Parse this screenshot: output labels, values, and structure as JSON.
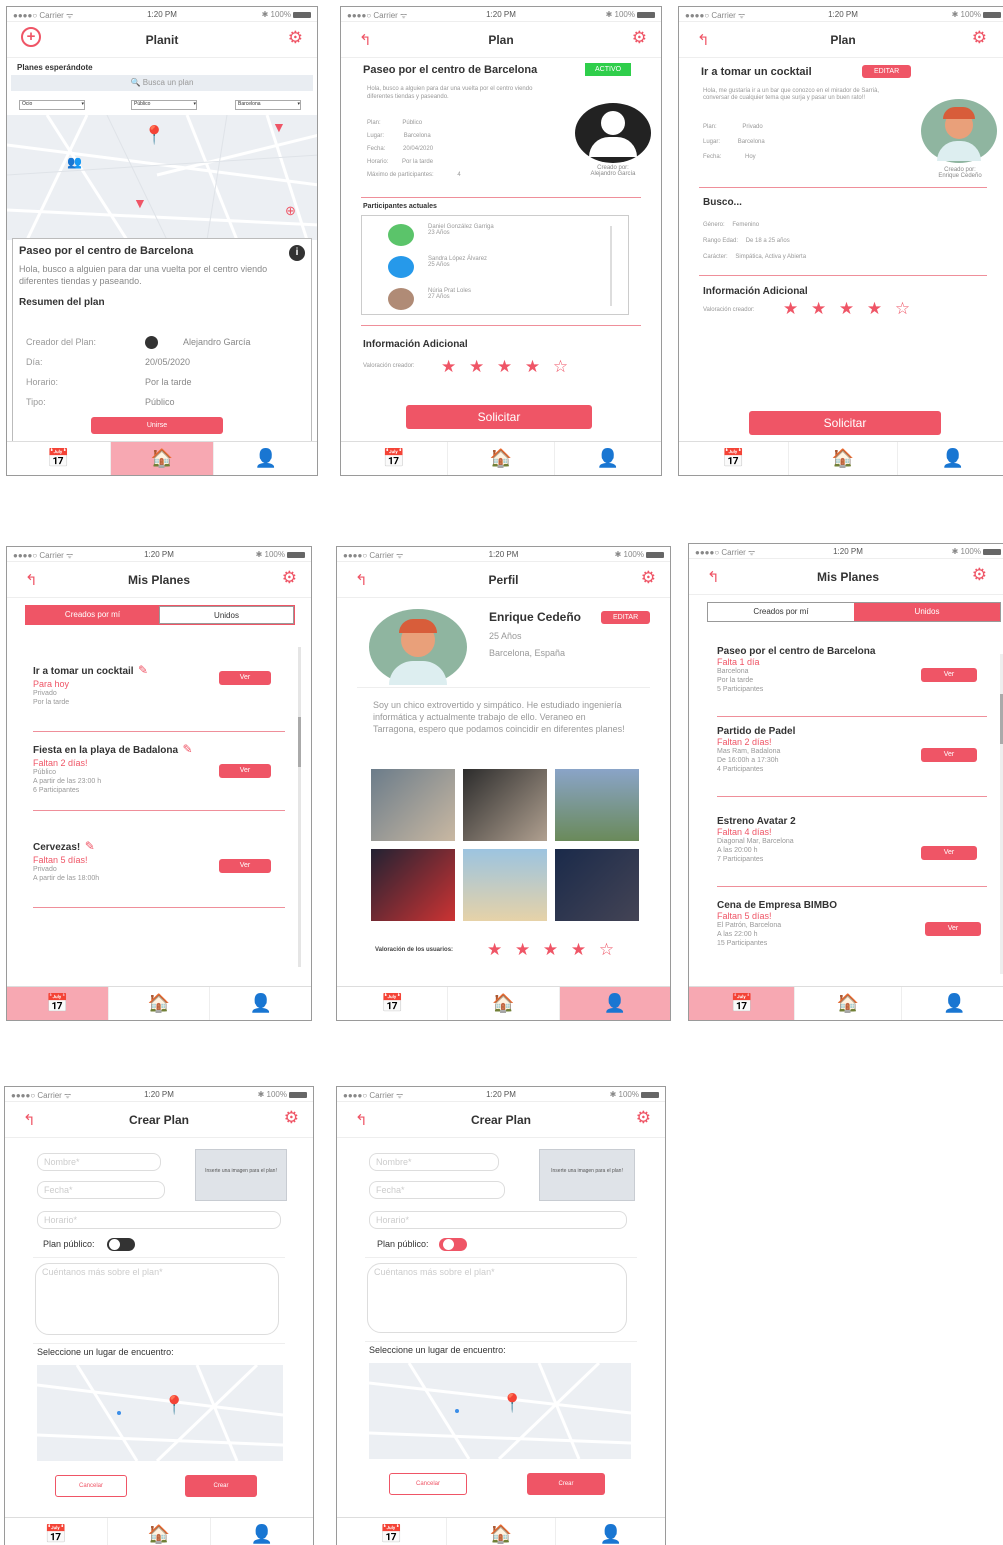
{
  "status": {
    "carrier": "●●●●○ Carrier ᯤ",
    "time": "1:20 PM",
    "battery": "✱ 100%"
  },
  "tabs": {
    "calendar": "📅",
    "home": "🏠",
    "profile": "👤"
  },
  "s1": {
    "title": "Planit",
    "section": "Planes esperándote",
    "search": "🔍 Busca un plan",
    "filters": [
      "Ocio",
      "Público",
      "Barcelona"
    ],
    "card": {
      "title": "Paseo por el centro de Barcelona",
      "desc": "Hola, busco a alguien para dar una vuelta por el centro viendo diferentes tiendas y paseando.",
      "summary": "Resumen del plan",
      "creator_label": "Creador del Plan:",
      "creator": "Alejandro García",
      "day_label": "Día:",
      "day": "20/05/2020",
      "time_label": "Horario:",
      "time": "Por la tarde",
      "type_label": "Tipo:",
      "type": "Público",
      "join": "Unirse"
    }
  },
  "s2": {
    "title": "Plan",
    "plan": "Paseo por el centro de Barcelona",
    "badge": "ACTIVO",
    "desc": "Hola, busco a alguien para dar una vuelta por el centro viendo diferentes tiendas y paseando.",
    "rows": [
      {
        "k": "Plan:",
        "v": "Público"
      },
      {
        "k": "Lugar:",
        "v": "Barcelona"
      },
      {
        "k": "Fecha:",
        "v": "20/04/2020"
      },
      {
        "k": "Horario:",
        "v": "Por la tarde"
      },
      {
        "k": "Máximo de participantes:",
        "v": "4"
      }
    ],
    "created": "Creado por:",
    "creator": "Alejandro García",
    "participants_title": "Participantes actuales",
    "participants": [
      {
        "name": "Daniel González Garriga",
        "age": "23 Años"
      },
      {
        "name": "Sandra López Álvarez",
        "age": "25 Años"
      },
      {
        "name": "Núria Prat Loles",
        "age": "27 Años"
      }
    ],
    "info": "Información Adicional",
    "rating_label": "Valoración creador:",
    "stars": "★ ★ ★ ★ ☆",
    "cta": "Solicitar"
  },
  "s3": {
    "title": "Plan",
    "plan": "Ir a tomar un cocktail",
    "badge": "EDITAR",
    "desc": "Hola, me gustaría ir a un bar que conozco en el mirador de Sarrià, conversar de cualquier tema que surja y pasar un buen rato!!",
    "rows": [
      {
        "k": "Plan:",
        "v": "Privado"
      },
      {
        "k": "Lugar:",
        "v": "Barcelona"
      },
      {
        "k": "Fecha:",
        "v": "Hoy"
      }
    ],
    "created": "Creado por:",
    "creator": "Enrique Cedeño",
    "busco": "Busco...",
    "brows": [
      {
        "k": "Género:",
        "v": "Femenino"
      },
      {
        "k": "Rango Edad:",
        "v": "De 18 a 25 años"
      },
      {
        "k": "Carácter:",
        "v": "Simpática, Activa y Abierta"
      }
    ],
    "info": "Información Adicional",
    "rating_label": "Valoración creador:",
    "stars": "★ ★ ★ ★ ☆",
    "cta": "Solicitar"
  },
  "s4": {
    "title": "Mis Planes",
    "seg": [
      "Creados por mí",
      "Unidos"
    ],
    "items": [
      {
        "title": "Ir a tomar un cocktail",
        "status": "Para hoy",
        "lines": [
          "Privado",
          "Por la tarde"
        ]
      },
      {
        "title": "Fiesta en la playa de Badalona",
        "status": "Faltan 2 días!",
        "lines": [
          "Público",
          "A partir de las 23:00 h",
          "6 Participantes"
        ]
      },
      {
        "title": "Cervezas!",
        "status": "Faltan 5 días!",
        "lines": [
          "Privado",
          "A partir de las 18:00h"
        ]
      }
    ],
    "ver": "Ver"
  },
  "s5": {
    "title": "Perfil",
    "name": "Enrique Cedeño",
    "edit": "EDITAR",
    "age": "25 Años",
    "city": "Barcelona, España",
    "bio": "Soy un chico extrovertido y simpático. He estudiado ingeniería informática y actualmente trabajo de ello. Veraneo en Tarragona, espero que podamos coincidir en diferentes planes!",
    "rating_label": "Valoración de los usuarios:",
    "stars": "★ ★ ★ ★ ☆"
  },
  "s6": {
    "title": "Mis Planes",
    "seg": [
      "Creados por mí",
      "Unidos"
    ],
    "items": [
      {
        "title": "Paseo por el centro de Barcelona",
        "status": "Falta 1 día",
        "lines": [
          "Barcelona",
          "Por la tarde",
          "5 Participantes"
        ]
      },
      {
        "title": "Partido de Padel",
        "status": "Faltan 2 días!",
        "lines": [
          "Mas Ram, Badalona",
          "De 16:00h a 17:30h",
          "4 Participantes"
        ]
      },
      {
        "title": "Estreno Avatar 2",
        "status": "Faltan 4 días!",
        "lines": [
          "Diagonal Mar, Barcelona",
          "A las 20:00 h",
          "7 Participantes"
        ]
      },
      {
        "title": "Cena de Empresa BIMBO",
        "status": "Faltan 5 días!",
        "lines": [
          "El Patrón, Barcelona",
          "A las 22:00 h",
          "15 Participantes"
        ]
      }
    ],
    "ver": "Ver"
  },
  "create": {
    "title": "Crear Plan",
    "name": "Nombre*",
    "date": "Fecha*",
    "time": "Horario*",
    "image": "Inserte una imagen para el plan!",
    "public": "Plan público:",
    "about": "Cuéntanos más sobre el plan*",
    "place": "Seleccione un lugar de encuentro:",
    "cancel": "Cancelar",
    "create": "Crear"
  }
}
